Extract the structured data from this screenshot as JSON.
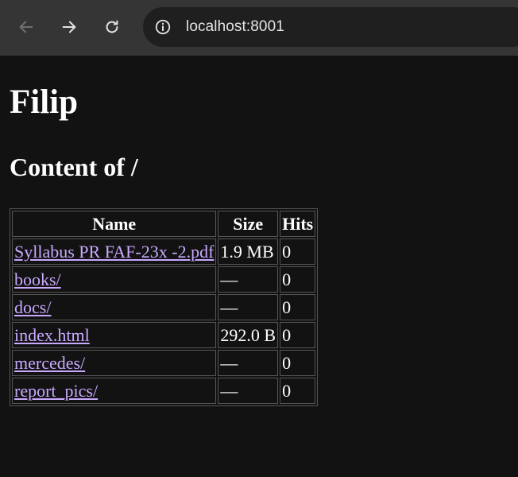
{
  "browser": {
    "url": "localhost:8001",
    "icons": {
      "back": "arrow-left-icon",
      "forward": "arrow-right-icon",
      "reload": "reload-icon",
      "site_info": "info-icon"
    }
  },
  "page": {
    "title": "Filip",
    "subtitle": "Content of /"
  },
  "table": {
    "headers": [
      "Name",
      "Size",
      "Hits"
    ],
    "rows": [
      {
        "name": "Syllabus PR FAF-23x -2.pdf",
        "size": "1.9 MB",
        "hits": "0"
      },
      {
        "name": "books/",
        "size": "—",
        "hits": "0"
      },
      {
        "name": "docs/",
        "size": "—",
        "hits": "0"
      },
      {
        "name": "index.html",
        "size": "292.0 B",
        "hits": "0"
      },
      {
        "name": "mercedes/",
        "size": "—",
        "hits": "0"
      },
      {
        "name": "report_pics/",
        "size": "—",
        "hits": "0"
      }
    ]
  },
  "colors": {
    "chrome_bar": "#353535",
    "omnibox": "#1f1f1f",
    "page_bg": "#121212",
    "link": "#c8a9ff",
    "border": "#555555"
  }
}
